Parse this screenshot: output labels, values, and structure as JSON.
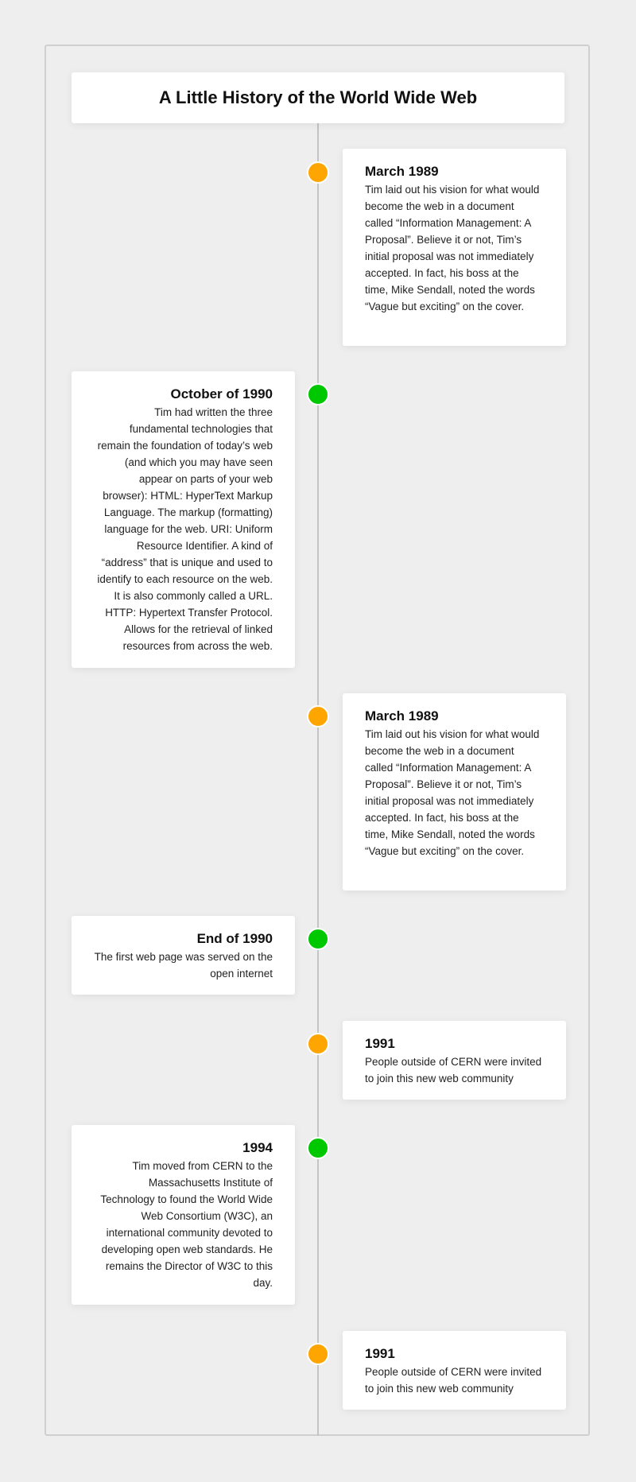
{
  "title": "A Little History of the World Wide Web",
  "colors": {
    "dot_odd": "#ffa500",
    "dot_even": "#00c800"
  },
  "events": [
    {
      "date": "March 1989",
      "text": "Tim laid out his vision for what would become the web in a document called “Information Management: A Proposal”. Believe it or not, Tim’s initial proposal was not immediately accepted. In fact, his boss at the time, Mike Sendall, noted the words “Vague but exciting” on the cover.",
      "side": "right",
      "color": "#ffa500"
    },
    {
      "date": "October of 1990",
      "text": "Tim had written the three fundamental technologies that remain the foundation of today’s web (and which you may have seen appear on parts of your web browser): HTML: HyperText Markup Language. The markup (formatting) language for the web. URI: Uniform Resource Identifier. A kind of “address” that is unique and used to identify to each resource on the web. It is also commonly called a URL. HTTP: Hypertext Transfer Protocol. Allows for the retrieval of linked resources from across the web.",
      "side": "left",
      "color": "#00c800"
    },
    {
      "date": "March 1989",
      "text": "Tim laid out his vision for what would become the web in a document called “Information Management: A Proposal”. Believe it or not, Tim’s initial proposal was not immediately accepted. In fact, his boss at the time, Mike Sendall, noted the words “Vague but exciting” on the cover.",
      "side": "right",
      "color": "#ffa500"
    },
    {
      "date": "End of 1990",
      "text": "The first web page was served on the open internet",
      "side": "left",
      "color": "#00c800"
    },
    {
      "date": "1991",
      "text": "People outside of CERN were invited to join this new web community",
      "side": "right",
      "color": "#ffa500"
    },
    {
      "date": "1994",
      "text": "Tim moved from CERN to the Massachusetts Institute of Technology to found the World Wide Web Consortium (W3C), an international community devoted to developing open web standards. He remains the Director of W3C to this day.",
      "side": "left",
      "color": "#00c800"
    },
    {
      "date": "1991",
      "text": "People outside of CERN were invited to join this new web community",
      "side": "right",
      "color": "#ffa500"
    }
  ]
}
